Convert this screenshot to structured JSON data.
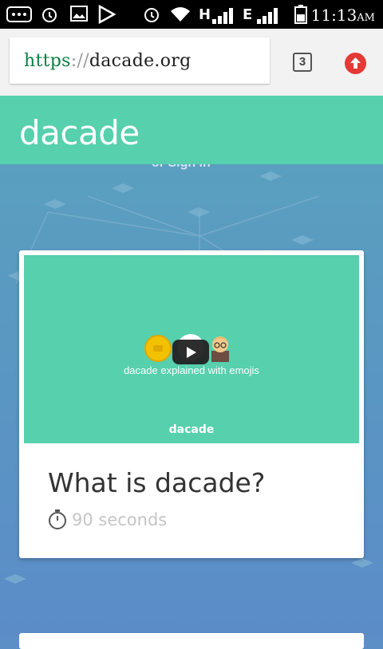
{
  "status_bar": {
    "network_type": "H",
    "network_type_2": "E",
    "time": "11:13",
    "ampm": "AM",
    "icons": [
      "message-icon",
      "alarm-icon",
      "image-icon",
      "play-store-icon",
      "alarm-icon",
      "wifi-icon",
      "signal-icon",
      "signal-icon",
      "battery-icon"
    ]
  },
  "browser": {
    "url_scheme": "https",
    "url_separator": "://",
    "url_host": "dacade.org",
    "tab_count": "3",
    "update_icon": "arrow-up-icon",
    "colors": {
      "update_button": "#e53935",
      "scheme": "#0b8043"
    }
  },
  "site": {
    "logo": "dacade",
    "header_color": "#56d0ad",
    "peek_text": "or Sign in"
  },
  "card": {
    "video": {
      "caption": "dacade explained with emojis",
      "logo": "dacade",
      "emojis": [
        "coin-icon",
        "play-button-icon",
        "teacher-icon"
      ]
    },
    "title": "What is dacade?",
    "duration_icon": "stopwatch-icon",
    "duration": "90 seconds"
  }
}
